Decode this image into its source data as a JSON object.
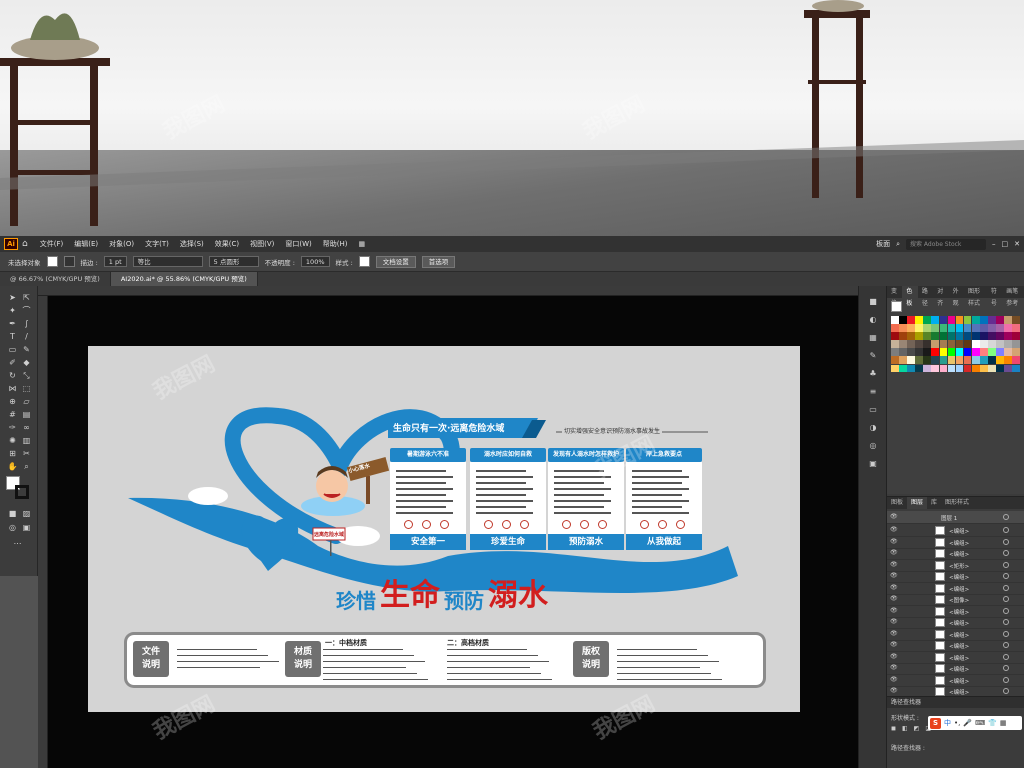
{
  "menubar": {
    "app_logo": "Ai",
    "items": [
      "文件(F)",
      "编辑(E)",
      "对象(O)",
      "文字(T)",
      "选择(S)",
      "效果(C)",
      "视图(V)",
      "窗口(W)",
      "帮助(H)"
    ],
    "workspace": "板面",
    "search_placeholder": "搜索 Adobe Stock"
  },
  "controlbar": {
    "selection_status": "未选择对象",
    "stroke_label": "描边 :",
    "stroke_value": "1 pt",
    "stroke_style": "等比",
    "brush_label": "5 点圆形",
    "opacity_label": "不透明度 :",
    "opacity_value": "100%",
    "style_label": "样式 :",
    "doc_settings": "文档设置",
    "preferences": "首选项"
  },
  "tabs": [
    {
      "label": "@ 66.67% (CMYK/GPU 预览)"
    },
    {
      "label": "AI2020.ai* @ 55.86% (CMYK/GPU 预览)"
    }
  ],
  "right_panel": {
    "swatch_tabs": [
      "变换",
      "色板",
      "路径",
      "对齐",
      "外观",
      "图形样式",
      "符号",
      "画笔参考"
    ],
    "layers_tabs": [
      "图板",
      "图层",
      "库",
      "图形样式"
    ],
    "layer_top": "图层 1",
    "layer_items": [
      "<编组>",
      "<编组>",
      "<编组>",
      "<矩形>",
      "<编组>",
      "<编组>",
      "<图像>",
      "<编组>",
      "<编组>",
      "<编组>",
      "<编组>",
      "<编组>",
      "<编组>",
      "<编组>",
      "<编组>",
      "<编组>"
    ],
    "pathfinder_title": "路径查找器",
    "pathfinder_shape_mode": "形状模式 :",
    "pathfinder_label": "路径查找器 :"
  },
  "artboard": {
    "banner_title": "生命只有一次·远离危险水域",
    "banner_sub": "切实增强安全意识预防溺水事故发生",
    "sign_text": "小心落水",
    "small_sign_text": "远离危险水域",
    "card_titles": [
      "暑期游泳六不准",
      "溺水时应如何自救",
      "发现有人溺水时怎样救护",
      "岸上急救要点"
    ],
    "card_footers": [
      "安全第一",
      "珍爱生命",
      "预防溺水",
      "从我做起"
    ],
    "slogan_1": "珍惜",
    "slogan_2": "生命",
    "slogan_3": "预防",
    "slogan_4": "溺水",
    "info_labels": [
      "文件\n说明",
      "材质\n说明",
      "版权\n说明"
    ],
    "info_mid_1": "一：中档材质",
    "info_mid_2": "二：高档材质"
  },
  "watermark": "我图网",
  "colors": {
    "accent_blue": "#1f86c8",
    "slogan_red": "#d21e1e",
    "ai_orange": "#ff9a00"
  }
}
